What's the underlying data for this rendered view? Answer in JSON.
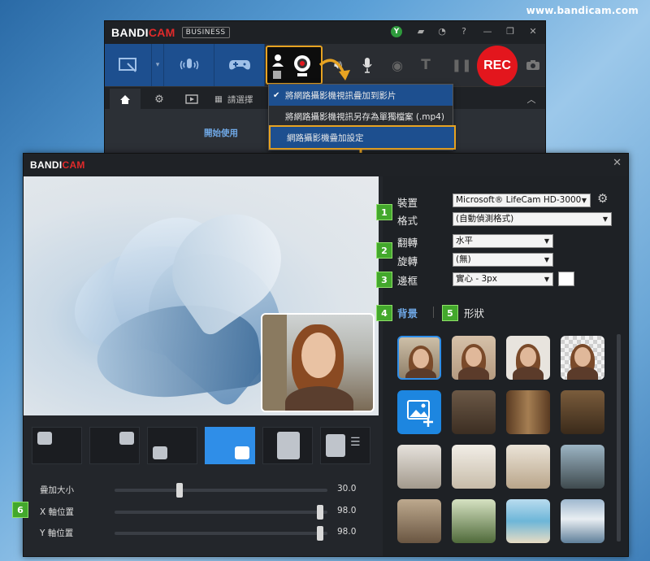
{
  "watermark": "www.bandicam.com",
  "main_window": {
    "brand_a": "BANDI",
    "brand_b": "CAM",
    "edition": "BUSINESS",
    "user_badge": "Y",
    "rec_label": "REC",
    "tabs_label": "請選擇",
    "body_label": "開始使用"
  },
  "webcam_menu": {
    "items": [
      {
        "label": "將網路攝影機視訊疊加到影片",
        "checked": true
      },
      {
        "label": "將網路攝影機視訊另存為單獨檔案 (.mp4)",
        "checked": false
      },
      {
        "label": "網路攝影機疊加設定",
        "checked": false
      }
    ]
  },
  "overlay_dialog": {
    "brand_a": "BANDI",
    "brand_b": "CAM",
    "close": "✕",
    "sliders": [
      {
        "label": "疊加大小",
        "value": "30.0",
        "level": 0.3
      },
      {
        "label": "X 軸位置",
        "value": "98.0",
        "level": 0.98
      },
      {
        "label": "Y 軸位置",
        "value": "98.0",
        "level": 0.98
      }
    ],
    "settings": {
      "device_label": "裝置",
      "device_value": "Microsoft® LifeCam HD-3000",
      "format_label": "格式",
      "format_value": "(自動偵測格式)",
      "flip_label": "翻轉",
      "flip_value": "水平",
      "rotate_label": "旋轉",
      "rotate_value": "(無)",
      "border_label": "邊框",
      "border_value": "實心 - 3px",
      "border_color": "#ffffff"
    },
    "tab_background": "背景",
    "tab_shape": "形狀",
    "markers": [
      "1",
      "2",
      "3",
      "4",
      "5",
      "6"
    ]
  },
  "colors": {
    "accent": "#2f8ee8",
    "highlight": "#e7a322",
    "rec": "#e3161d",
    "marker": "#43a82c"
  }
}
